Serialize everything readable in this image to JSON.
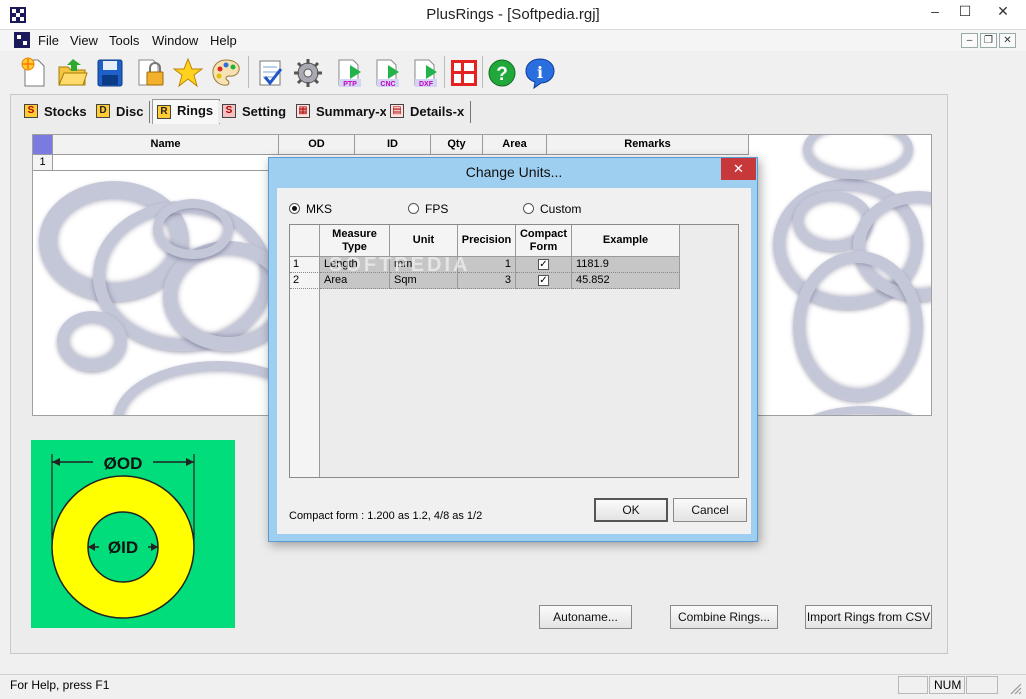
{
  "window": {
    "title": "PlusRings - [Softpedia.rgj]",
    "controls": {
      "minimize": "–",
      "maximize": "☐",
      "close": "✕"
    }
  },
  "menu": {
    "items": [
      "File",
      "View",
      "Tools",
      "Window",
      "Help"
    ]
  },
  "mdi_controls": {
    "minimize": "–",
    "restore": "❐",
    "close": "✕"
  },
  "toolbar": {
    "buttons": [
      "new-file-icon",
      "open-folder-icon",
      "save-icon",
      "lock-icon",
      "star-icon",
      "palette-icon",
      "checklist-icon",
      "gear-icon",
      "ptp-export-icon",
      "cnc-export-icon",
      "dxf-export-icon",
      "layout-grid-icon",
      "help-icon",
      "info-icon"
    ],
    "labels": {
      "ptp": "PTP",
      "cnc": "CNC",
      "dxf": "DXF",
      "help": "?",
      "info": "i"
    }
  },
  "tabs": [
    {
      "label": "Stocks",
      "icon": "S"
    },
    {
      "label": "Disc",
      "icon": "D"
    },
    {
      "label": "Rings",
      "icon": "R",
      "active": true
    },
    {
      "label": "Setting",
      "icon": "S"
    },
    {
      "label": "Summary-x",
      "icon": "▦"
    },
    {
      "label": "Details-x",
      "icon": "▤"
    }
  ],
  "grid": {
    "columns": [
      "Name",
      "OD",
      "ID",
      "Qty",
      "Area",
      "Remarks"
    ],
    "row_numbers": [
      "1"
    ]
  },
  "diagram": {
    "od_label": "ØOD",
    "id_label": "ØID",
    "colors": {
      "background": "#00dd7a",
      "ring": "#ffff00"
    }
  },
  "buttons": {
    "autoname": "Autoname...",
    "combine": "Combine Rings...",
    "import_csv": "Import Rings from CSV"
  },
  "status": {
    "help_text": "For Help, press F1",
    "num": "NUM"
  },
  "dialog": {
    "title": "Change Units...",
    "close": "✕",
    "units": {
      "mks": "MKS",
      "fps": "FPS",
      "custom": "Custom",
      "selected": "MKS"
    },
    "table": {
      "headers": [
        "Measure Type",
        "Unit",
        "Precision",
        "Compact Form",
        "Example"
      ],
      "rows": [
        {
          "n": "1",
          "type": "Length",
          "unit": "mm",
          "precision": "1",
          "compact": true,
          "example": "1181.9"
        },
        {
          "n": "2",
          "type": "Area",
          "unit": "Sqm",
          "precision": "3",
          "compact": true,
          "example": "45.852"
        }
      ]
    },
    "note": "Compact form : 1.200 as 1.2,  4/8 as 1/2",
    "ok": "OK",
    "cancel": "Cancel",
    "check_mark": "✓"
  },
  "watermark": "SOFTPEDIA"
}
